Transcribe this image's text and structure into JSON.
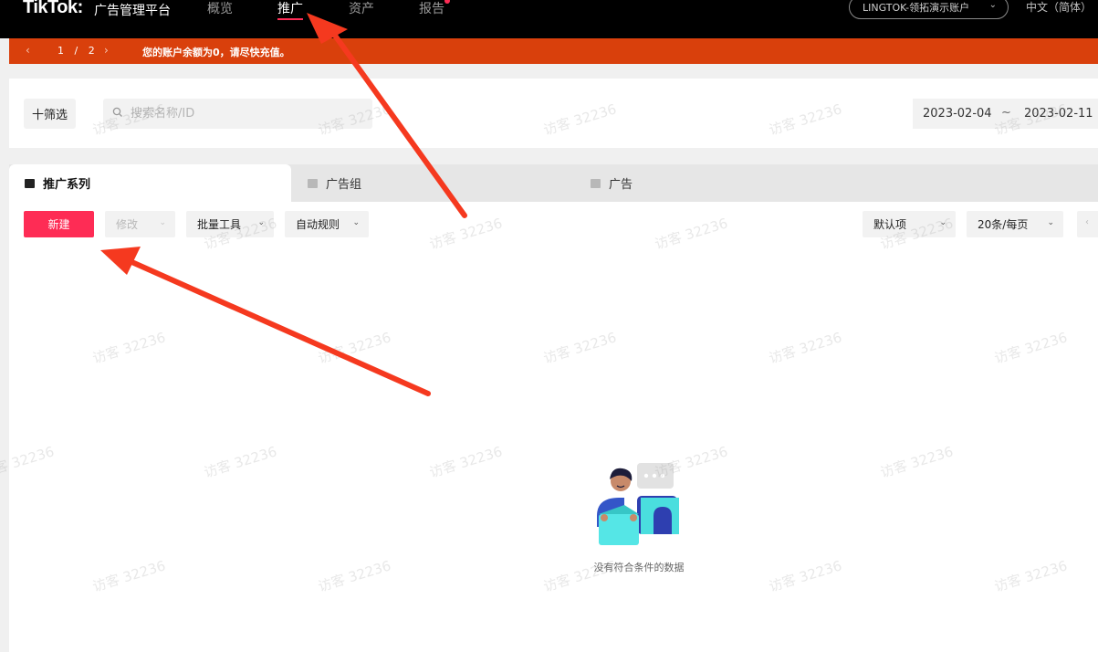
{
  "header": {
    "logo": "TikTok:",
    "logo_sub": "广告管理平台",
    "nav": [
      "概览",
      "推广",
      "资产",
      "报告"
    ],
    "active_nav": "推广",
    "account": "LINGTOK-领拓演示账户",
    "language": "中文（简体）"
  },
  "alert": {
    "page": "1",
    "page_sep": "/",
    "total": "2",
    "message": "您的账户余额为0，请尽快充值。",
    "color": "#d9400c"
  },
  "filters": {
    "filter_label": "十筛选",
    "search_placeholder": "搜索名称/ID",
    "date_start": "2023-02-04",
    "date_sep": "~",
    "date_end": "2023-02-11"
  },
  "tabs": [
    "推广系列",
    "广告组",
    "广告"
  ],
  "toolbar": {
    "new_label": "新建",
    "edit_label": "修改",
    "batch_label": "批量工具",
    "rules_label": "自动规则",
    "default_label": "默认项",
    "page_size_label": "20条/每页"
  },
  "empty_text": "没有符合条件的数据",
  "watermark": "访客 32236",
  "colors": {
    "accent": "#fe2c55",
    "annotation_arrow": "#f5391f"
  }
}
